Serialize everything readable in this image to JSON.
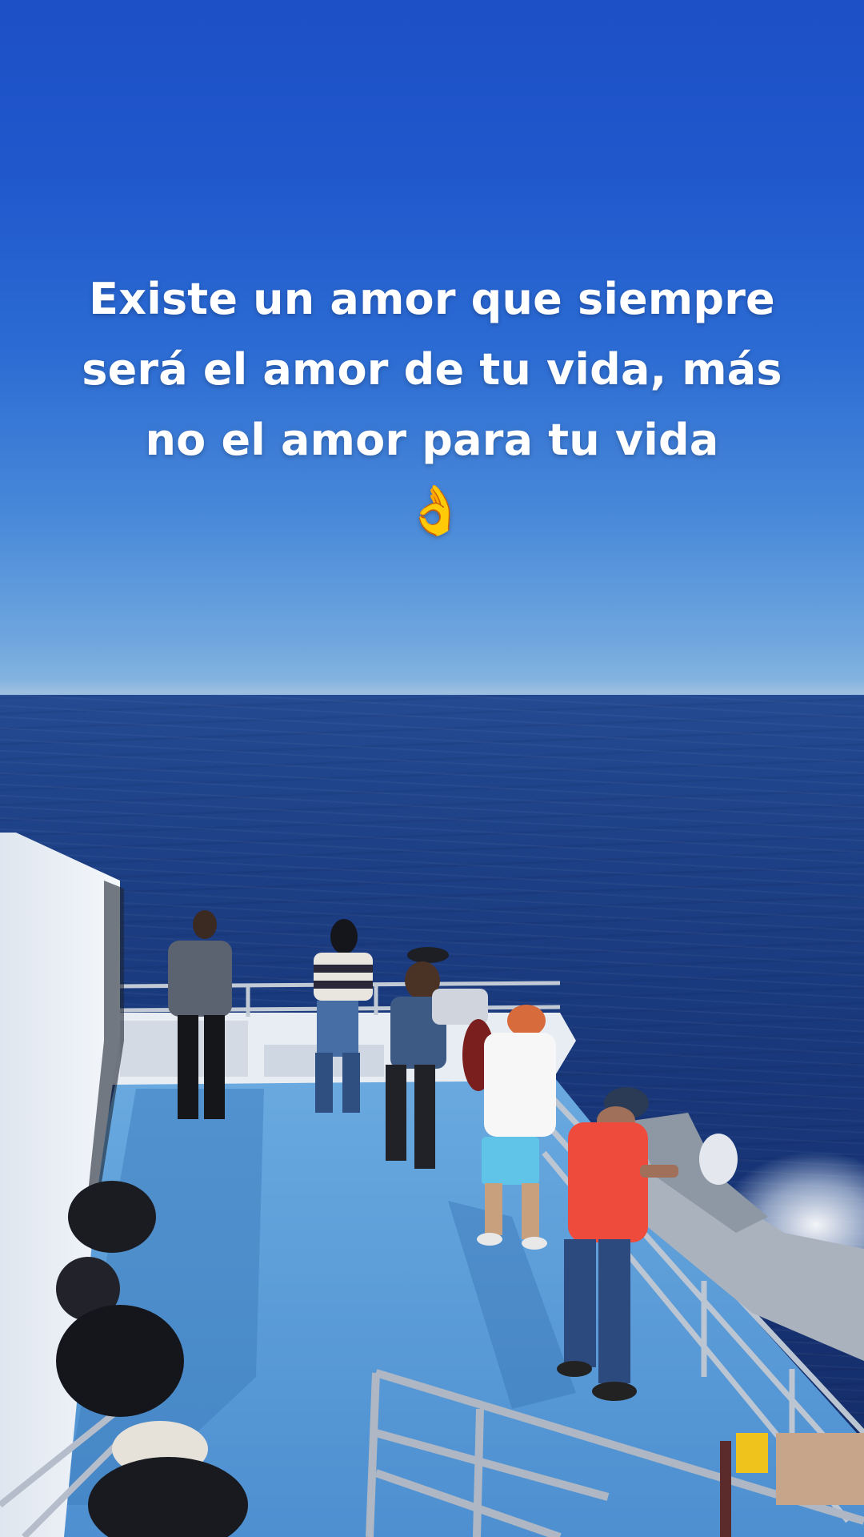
{
  "caption": {
    "line1": "Existe un amor que siempre",
    "line2": "será el amor de tu vida, más",
    "line3": "no el amor para tu vida",
    "emoji": "👌"
  },
  "colors": {
    "sky_top": "#1d4fc6",
    "sky_horizon": "#8cb8e0",
    "sea": "#1d3f85",
    "deck": "#5fa2dc",
    "cabin": "#e9eef5",
    "railing": "#b9c3cf",
    "red_shirt": "#ef4b3c"
  }
}
